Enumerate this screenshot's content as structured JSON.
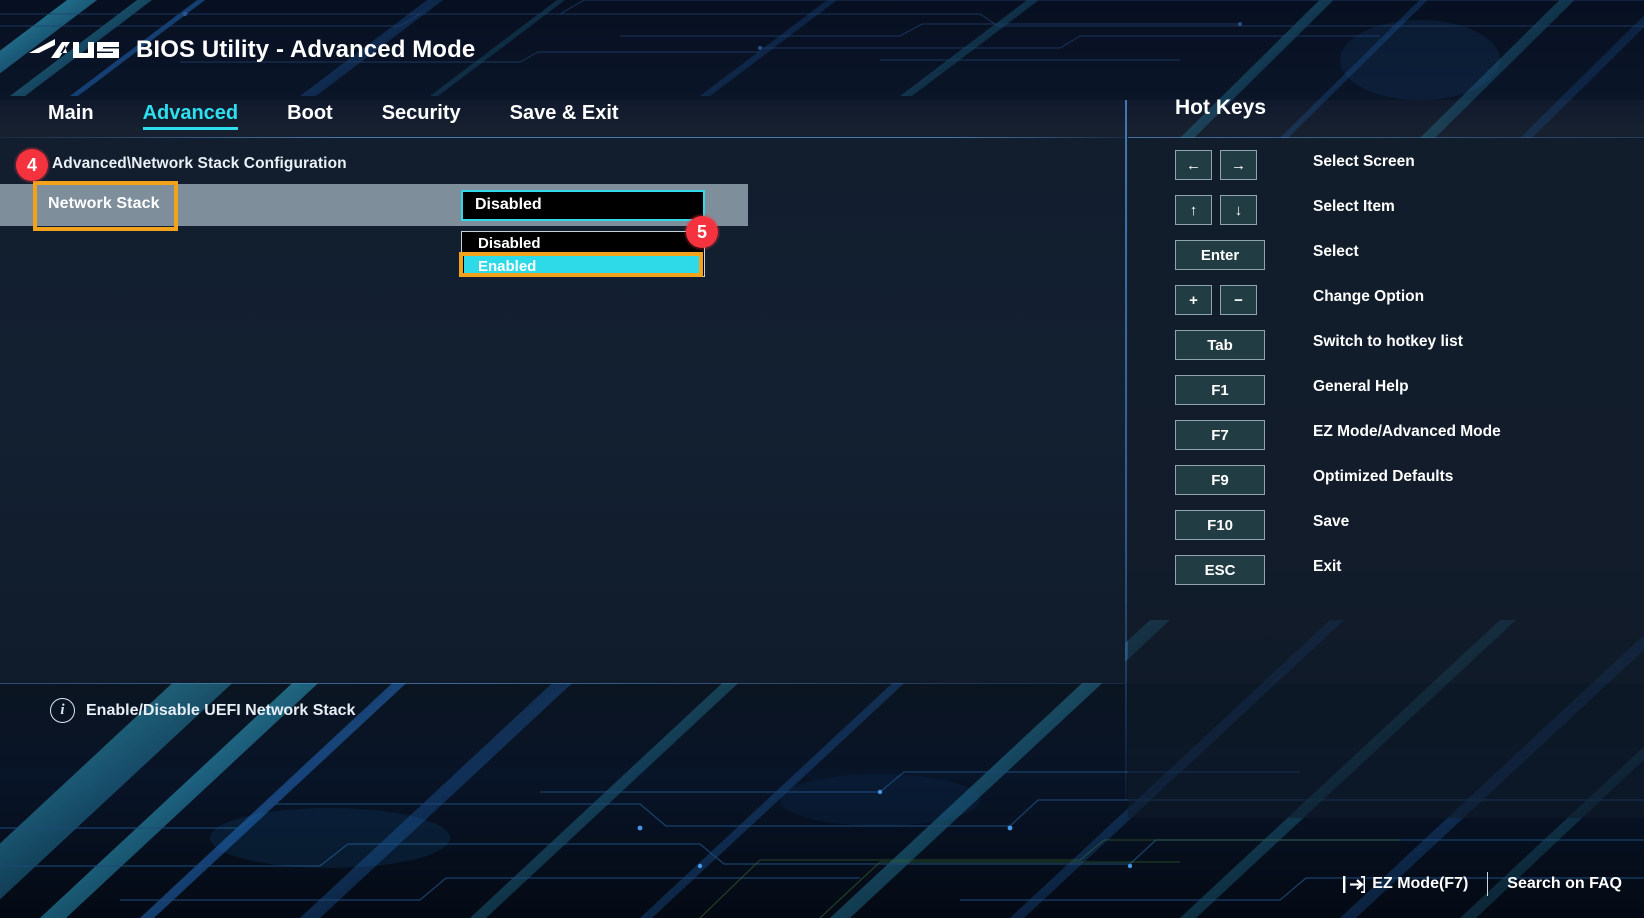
{
  "header": {
    "logo_alt": "asus-logo",
    "title": "BIOS Utility - Advanced Mode"
  },
  "nav": {
    "tabs": [
      {
        "label": "Main",
        "active": false
      },
      {
        "label": "Advanced",
        "active": true
      },
      {
        "label": "Boot",
        "active": false
      },
      {
        "label": "Security",
        "active": false
      },
      {
        "label": "Save & Exit",
        "active": false
      }
    ]
  },
  "main": {
    "breadcrumb": "Advanced\\Network Stack Configuration",
    "setting": {
      "label": "Network Stack",
      "current_value": "Disabled"
    },
    "dropdown": {
      "options": [
        {
          "label": "Disabled",
          "selected": false
        },
        {
          "label": "Enabled",
          "selected": true
        }
      ]
    },
    "help": {
      "icon": "info-icon",
      "text": "Enable/Disable UEFI Network Stack"
    }
  },
  "annotations": [
    {
      "number": "4",
      "target": "breadcrumb-and-network-stack-row"
    },
    {
      "number": "5",
      "target": "enabled-dropdown-option"
    }
  ],
  "hotkeys": {
    "title": "Hot Keys",
    "rows": [
      {
        "keys": [
          "←",
          "→"
        ],
        "size": "sm",
        "label": "Select Screen"
      },
      {
        "keys": [
          "↑",
          "↓"
        ],
        "size": "sm",
        "label": "Select Item"
      },
      {
        "keys": [
          "Enter"
        ],
        "size": "wide",
        "label": "Select"
      },
      {
        "keys": [
          "+",
          "−"
        ],
        "size": "sm",
        "label": "Change Option"
      },
      {
        "keys": [
          "Tab"
        ],
        "size": "wide",
        "label": "Switch to hotkey list"
      },
      {
        "keys": [
          "F1"
        ],
        "size": "wide",
        "label": "General Help"
      },
      {
        "keys": [
          "F7"
        ],
        "size": "wide",
        "label": "EZ Mode/Advanced Mode"
      },
      {
        "keys": [
          "F9"
        ],
        "size": "wide",
        "label": "Optimized Defaults"
      },
      {
        "keys": [
          "F10"
        ],
        "size": "wide",
        "label": "Save"
      },
      {
        "keys": [
          "ESC"
        ],
        "size": "wide",
        "label": "Exit"
      }
    ]
  },
  "bottombar": {
    "ez_mode_icon": "exit-arrow-icon",
    "ez_mode_label": "EZ Mode(F7)",
    "faq_label": "Search on FAQ"
  },
  "colors": {
    "accent_cyan": "#2ed9e8",
    "annotation_orange": "#f2a31b",
    "badge_red": "#f5333f",
    "row_highlight": "#7e8f9b",
    "panel_bg": "#132031"
  }
}
